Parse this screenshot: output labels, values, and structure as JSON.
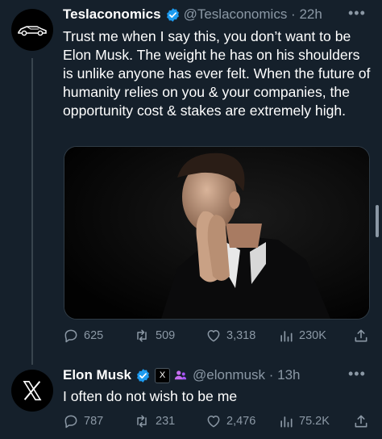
{
  "tweets": [
    {
      "author": "Teslaconomics",
      "handle": "@Teslaconomics",
      "time": "22h",
      "verified_color": "#1d9bf0",
      "text": "Trust me when I say this, you don’t want to be Elon Musk. The weight he has on his shoulders is unlike anyone has ever felt. When the future of humanity relies on you & your companies, the opportunity cost & stakes are extremely high.",
      "stats": {
        "replies": "625",
        "reposts": "509",
        "likes": "3,318",
        "views": "230K"
      }
    },
    {
      "author": "Elon Musk",
      "handle": "@elonmusk",
      "time": "13h",
      "verified_color": "#1d9bf0",
      "badge": "X",
      "text": "I often do not wish to be me",
      "stats": {
        "replies": "787",
        "reposts": "231",
        "likes": "2,476",
        "views": "75.2K"
      }
    }
  ],
  "icons": [
    "tesla-car-logo",
    "verified-icon",
    "more-icon",
    "reply-icon",
    "repost-icon",
    "like-icon",
    "views-icon",
    "share-icon",
    "x-logo",
    "x-badge-icon",
    "people-icon"
  ],
  "theme": {
    "background": "#15202b",
    "text": "#ffffff",
    "muted": "#8b98a5",
    "accent": "#1d9bf0"
  }
}
